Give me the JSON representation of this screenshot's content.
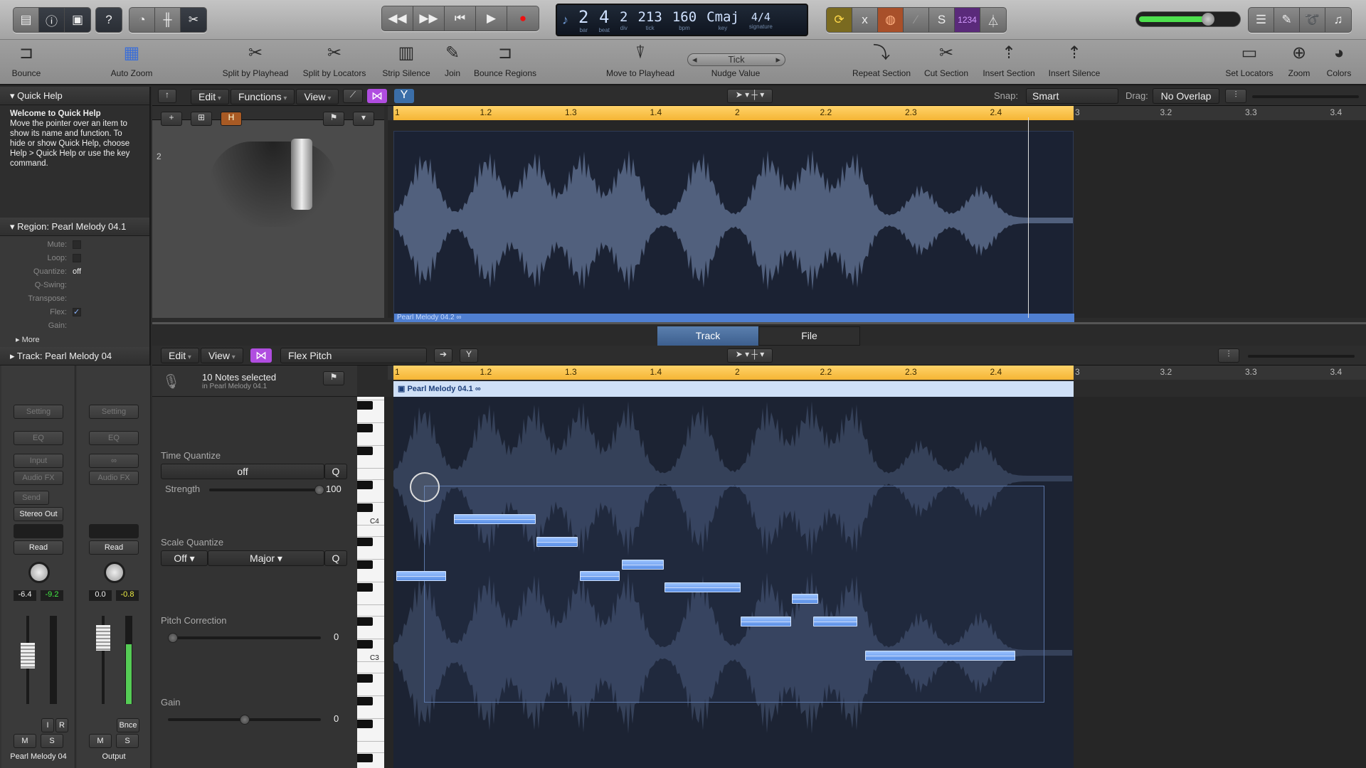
{
  "control_bar": {
    "left_buttons": [
      "library-icon",
      "info-icon",
      "smart-controls-icon",
      "quick-help-icon",
      "tuner-icon",
      "mixer-icon",
      "scissors-icon"
    ],
    "transport": [
      "rewind-icon",
      "fast-forward-icon",
      "go-to-start-icon",
      "play-icon",
      "record-icon"
    ],
    "lcd": {
      "bar": "2",
      "beat": "4",
      "div": "2",
      "tick": "213",
      "bpm": "160",
      "key": "Cmaj",
      "signature": "4/4",
      "units": {
        "bar": "bar",
        "beat": "beat",
        "div": "div",
        "tick": "tick",
        "bpm": "bpm",
        "key": "key",
        "signature": "signature"
      }
    },
    "mode_buttons": {
      "cycle": "cycle-icon",
      "replace": "x",
      "autopunch": "autopunch-icon",
      "tuning": "tuning-icon",
      "solo": "S",
      "count_in": "1234",
      "metronome": "metronome-icon"
    },
    "master_volume": 0.72,
    "right_buttons": [
      "list-editors-icon",
      "notepad-icon",
      "loops-icon",
      "browser-icon"
    ]
  },
  "toolbar": [
    {
      "label": "Bounce",
      "icon": "bounce-icon"
    },
    {
      "label": "Auto Zoom",
      "icon": "auto-zoom-icon"
    },
    {
      "label": "Split by Playhead",
      "icon": "scissors-icon"
    },
    {
      "label": "Split by Locators",
      "icon": "scissors-locators-icon"
    },
    {
      "label": "Strip Silence",
      "icon": "strip-silence-icon"
    },
    {
      "label": "Join",
      "icon": "glue-icon"
    },
    {
      "label": "Bounce Regions",
      "icon": "bounce-regions-icon"
    },
    {
      "label": "Move to Playhead",
      "icon": "joystick-icon"
    },
    {
      "label": "Nudge Value",
      "icon": "nudge-icon"
    },
    {
      "label": "Repeat Section",
      "icon": "repeat-section-icon"
    },
    {
      "label": "Cut Section",
      "icon": "cut-section-icon"
    },
    {
      "label": "Insert Section",
      "icon": "insert-section-icon"
    },
    {
      "label": "Insert Silence",
      "icon": "insert-silence-icon"
    },
    {
      "label": "Set Locators",
      "icon": "set-locators-icon"
    },
    {
      "label": "Zoom",
      "icon": "zoom-icon"
    },
    {
      "label": "Colors",
      "icon": "palette-icon"
    }
  ],
  "nudge_value": "Tick",
  "inspector": {
    "quick_help": {
      "title": "Quick Help",
      "heading": "Welcome to Quick Help",
      "body": "Move the pointer over an item to show its name and function. To hide or show Quick Help, choose Help > Quick Help or use the key command."
    },
    "region": {
      "title": "Region: Pearl Melody 04.1",
      "rows": [
        {
          "label": "Mute:",
          "value": ""
        },
        {
          "label": "Loop:",
          "value": ""
        },
        {
          "label": "Quantize:",
          "value": "off"
        },
        {
          "label": "Q-Swing:",
          "value": ""
        },
        {
          "label": "Transpose:",
          "value": ""
        },
        {
          "label": "Flex:",
          "value": "✓"
        },
        {
          "label": "Gain:",
          "value": ""
        }
      ],
      "more": "More"
    },
    "track": {
      "title": "Track:  Pearl Melody 04"
    },
    "strips": [
      {
        "setting": "Setting",
        "eq": "EQ",
        "input": "Input",
        "fx": "Audio FX",
        "send": "Send",
        "output": "Stereo Out",
        "automation": "Read",
        "vol": "-6.4",
        "peak": "-9.2",
        "ir": [
          "I",
          "R"
        ],
        "m": "M",
        "s": "S",
        "name": "Pearl Melody 04",
        "fader": 0.55,
        "meter": 0
      },
      {
        "setting": "Setting",
        "eq": "EQ",
        "input": "",
        "fx": "Audio FX",
        "send": "",
        "output": "",
        "automation": "Read",
        "vol": "0.0",
        "peak": "-0.8",
        "ir": [
          "Bnce"
        ],
        "m": "M",
        "s": "S",
        "name": "Output",
        "fader": 0.75,
        "meter": 0.68
      }
    ]
  },
  "tracks_area": {
    "menus": [
      "Edit",
      "Functions",
      "View"
    ],
    "snap_label": "Snap:",
    "snap": "Smart",
    "drag_label": "Drag:",
    "drag": "No Overlap",
    "track_number": "2",
    "ruler": [
      "1",
      "1.2",
      "1.3",
      "1.4",
      "2",
      "2.2",
      "2.3",
      "2.4",
      "3",
      "3.2",
      "3.3",
      "3.4"
    ],
    "region_name": "Pearl Melody 04.2"
  },
  "editor": {
    "tabs": [
      {
        "label": "Track",
        "active": true
      },
      {
        "label": "File",
        "active": false
      }
    ],
    "menus": [
      "Edit",
      "View"
    ],
    "mode": "Flex Pitch",
    "selection": {
      "title": "10 Notes selected",
      "subtitle": "in Pearl Melody 04.1"
    },
    "region_name": "Pearl Melody 04.1",
    "time_quantize": {
      "label": "Time Quantize",
      "value": "off",
      "q": "Q",
      "strength_label": "Strength",
      "strength": "100"
    },
    "scale_quantize": {
      "label": "Scale Quantize",
      "value": "Off",
      "scale": "Major",
      "q": "Q"
    },
    "pitch_correction": {
      "label": "Pitch Correction",
      "value": "0"
    },
    "gain": {
      "label": "Gain",
      "value": "0"
    },
    "key_labels": {
      "60": "C4",
      "48": "C3"
    },
    "notes": [
      {
        "start": 0.03,
        "length": 0.59,
        "pitch": 55
      },
      {
        "start": 0.71,
        "length": 0.96,
        "pitch": 60
      },
      {
        "start": 1.68,
        "length": 0.49,
        "pitch": 58
      },
      {
        "start": 2.19,
        "length": 0.47,
        "pitch": 55
      },
      {
        "start": 2.69,
        "length": 0.49,
        "pitch": 56
      },
      {
        "start": 3.19,
        "length": 0.89,
        "pitch": 54
      },
      {
        "start": 4.08,
        "length": 0.6,
        "pitch": 51
      },
      {
        "start": 4.69,
        "length": 0.31,
        "pitch": 53
      },
      {
        "start": 4.94,
        "length": 0.52,
        "pitch": 51
      },
      {
        "start": 5.55,
        "length": 1.76,
        "pitch": 48
      }
    ]
  },
  "colors": {
    "cycle": "#f5b534",
    "region": "#4f7fd1",
    "note": "#6f9ff0",
    "flex_purple": "#b04de0"
  }
}
